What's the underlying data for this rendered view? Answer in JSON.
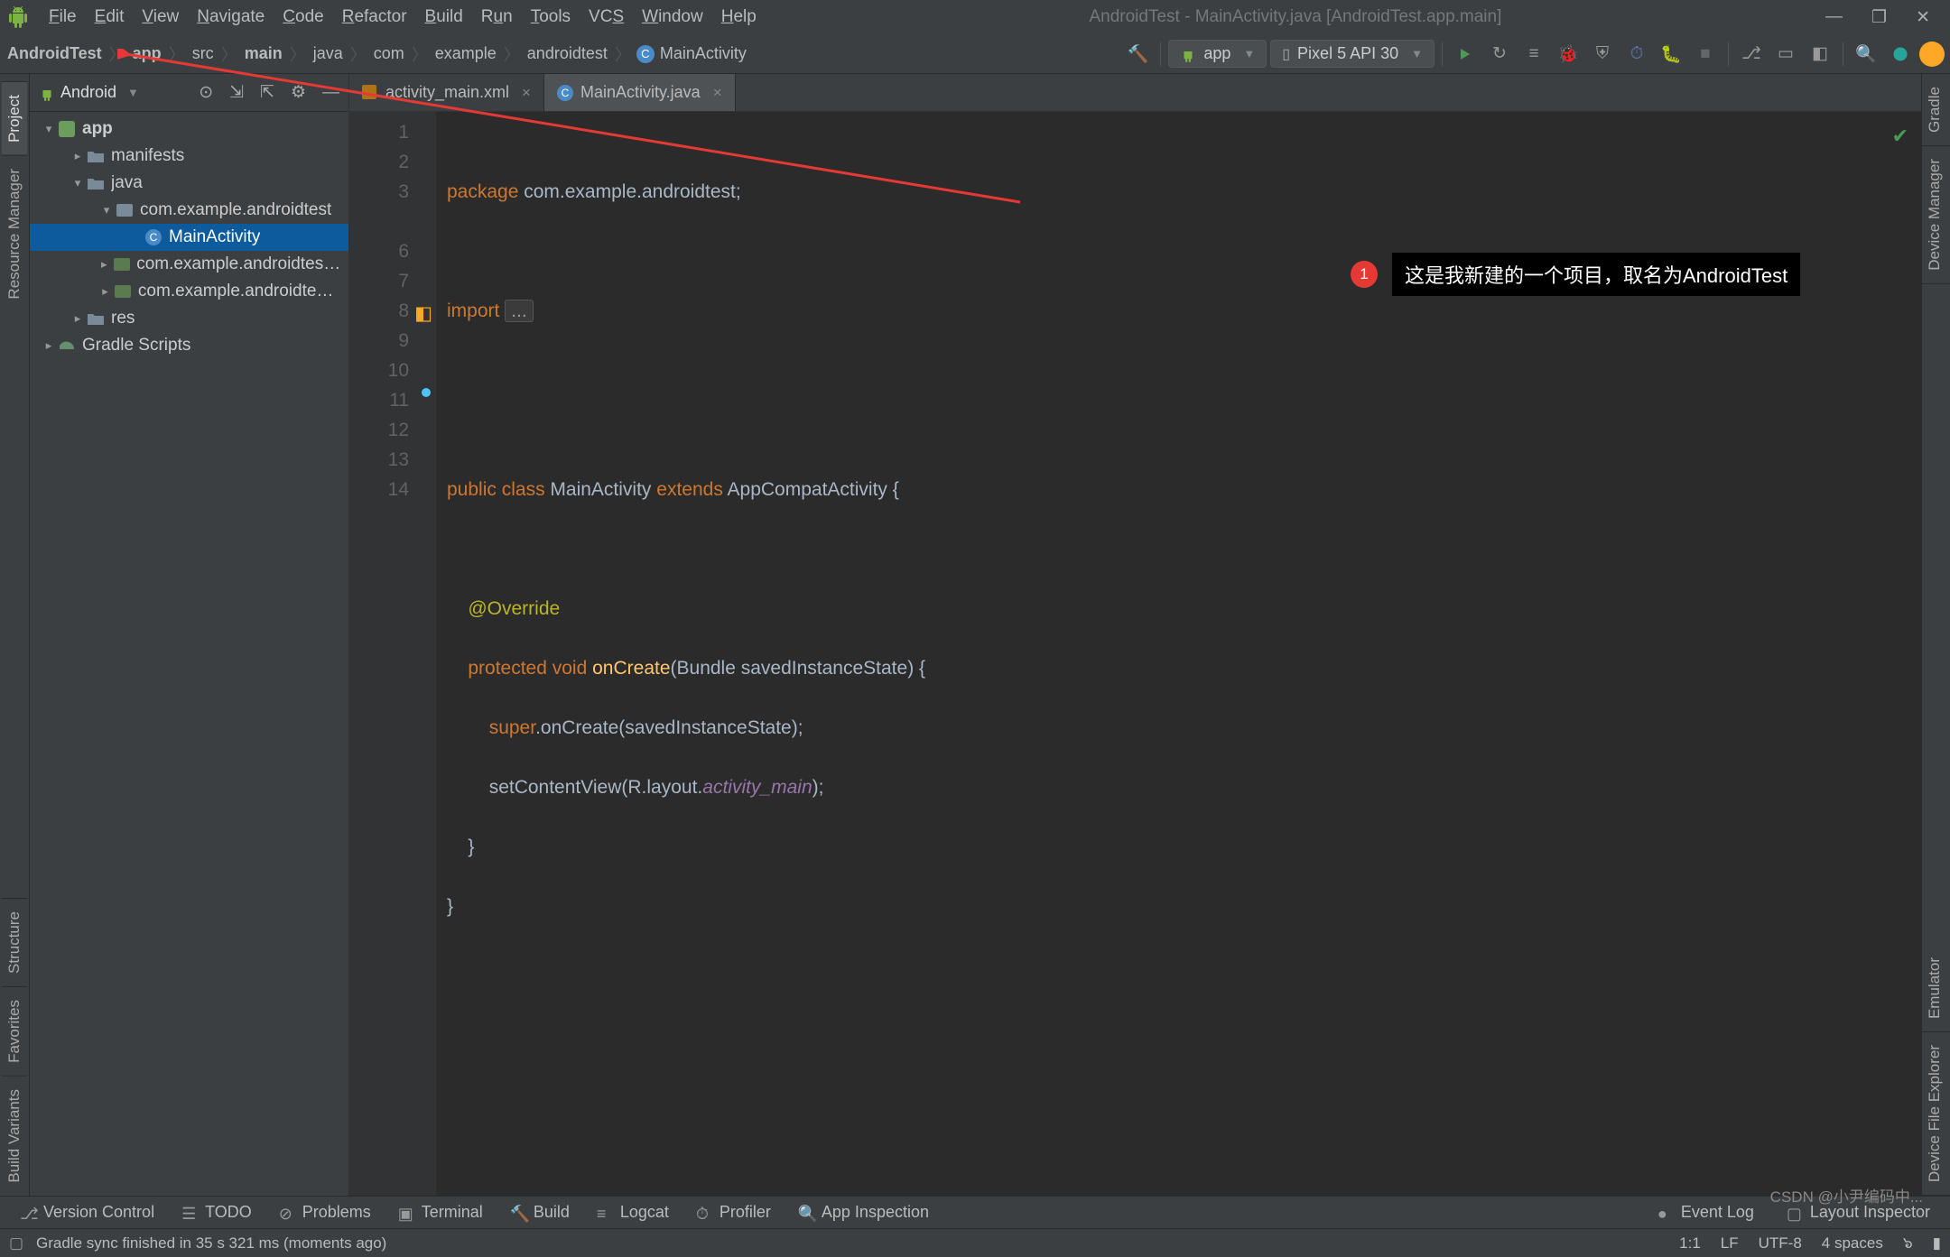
{
  "window": {
    "title": "AndroidTest - MainActivity.java [AndroidTest.app.main]"
  },
  "menu": {
    "file": "File",
    "edit": "Edit",
    "view": "View",
    "navigate": "Navigate",
    "code": "Code",
    "refactor": "Refactor",
    "build": "Build",
    "run": "Run",
    "tools": "Tools",
    "vcs": "VCS",
    "window": "Window",
    "help": "Help"
  },
  "breadcrumb": {
    "items": [
      "AndroidTest",
      "app",
      "src",
      "main",
      "java",
      "com",
      "example",
      "androidtest"
    ],
    "bold": {
      "0": true,
      "1": true,
      "3": true
    },
    "leaf": "MainActivity"
  },
  "run_config": {
    "label": "app"
  },
  "device": {
    "label": "Pixel 5 API 30"
  },
  "project_view": {
    "mode": "Android"
  },
  "tree": {
    "app": "app",
    "manifests": "manifests",
    "java": "java",
    "pkg_main": "com.example.androidtest",
    "main_activity": "MainActivity",
    "pkg_android_test": "com.example.androidtest (a",
    "pkg_unit_test": "com.example.androidtest (t",
    "res": "res",
    "gradle_scripts": "Gradle Scripts"
  },
  "tabs": {
    "t1": "activity_main.xml",
    "t2": "MainActivity.java"
  },
  "code": {
    "l1a": "package",
    "l1b": " com.example.androidtest;",
    "l3a": "import",
    "l3b": "...",
    "l7a": "public",
    "l7b": "class",
    "l7c": " MainActivity ",
    "l7d": "extends",
    "l7e": " AppCompatActivity {",
    "l9": "@Override",
    "l10a": "protected",
    "l10b": "void",
    "l10c": "onCreate",
    "l10d": "(Bundle savedInstanceState) {",
    "l11a": "super",
    "l11b": ".onCreate(savedInstanceState);",
    "l12a": "setContentView(R.layout.",
    "l12b": "activity_main",
    "l12c": ");",
    "l13": "    }",
    "l14": "}"
  },
  "annotation": {
    "badge": "1",
    "text": "这是我新建的一个项目，取名为AndroidTest"
  },
  "left_rail": {
    "project": "Project",
    "resource": "Resource Manager",
    "structure": "Structure",
    "favorites": "Favorites",
    "variants": "Build Variants"
  },
  "right_rail": {
    "gradle": "Gradle",
    "devmgr": "Device Manager",
    "emulator": "Emulator",
    "devfile": "Device File Explorer"
  },
  "bottom": {
    "vcs": "Version Control",
    "todo": "TODO",
    "problems": "Problems",
    "terminal": "Terminal",
    "build": "Build",
    "logcat": "Logcat",
    "profiler": "Profiler",
    "appinsp": "App Inspection",
    "eventlog": "Event Log",
    "layout": "Layout Inspector"
  },
  "status": {
    "msg": "Gradle sync finished in 35 s 321 ms (moments ago)",
    "pos": "1:1",
    "le": "LF",
    "enc": "UTF-8",
    "indent": "4 spaces",
    "watermark": "CSDN @小尹编码中..."
  }
}
